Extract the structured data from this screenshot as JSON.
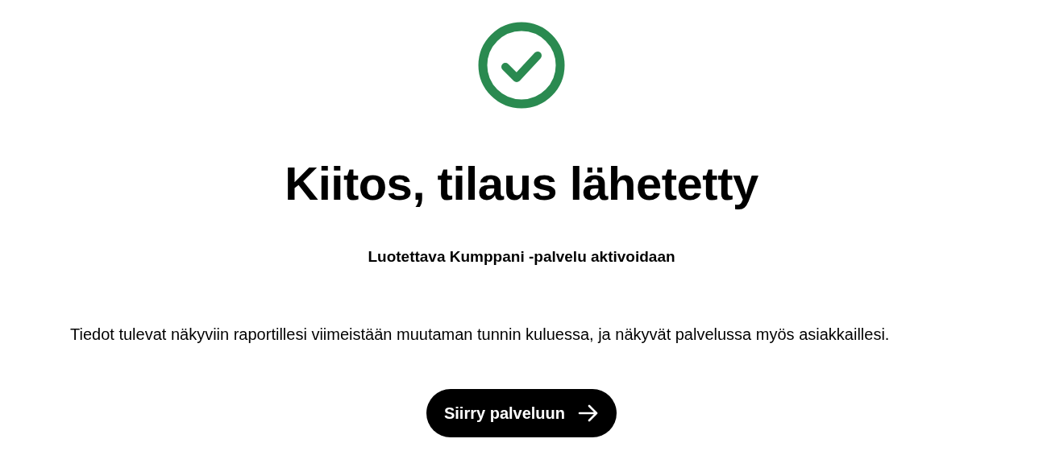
{
  "status": {
    "kind": "success"
  },
  "title": "Kiitos, tilaus lähetetty",
  "subtitle": "Luotettava Kumppani -palvelu aktivoidaan",
  "message": "Tiedot tulevat näkyviin raportillesi viimeistään muutaman tunnin kuluessa, ja näkyvät palvelussa myös asiakkaillesi.",
  "button": {
    "label": "Siirry palveluun"
  }
}
